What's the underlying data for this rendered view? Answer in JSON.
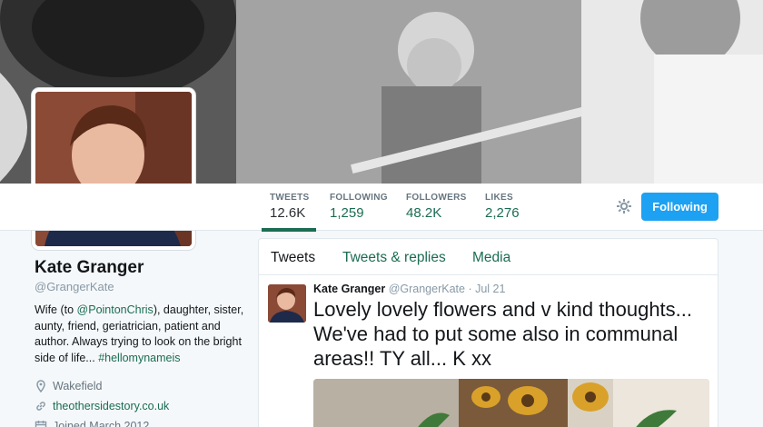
{
  "banner": {
    "alt": ""
  },
  "stats": [
    {
      "label": "TWEETS",
      "value": "12.6K"
    },
    {
      "label": "FOLLOWING",
      "value": "1,259"
    },
    {
      "label": "FOLLOWERS",
      "value": "48.2K"
    },
    {
      "label": "LIKES",
      "value": "2,276"
    }
  ],
  "follow_button": "Following",
  "profile": {
    "name": "Kate Granger",
    "handle": "@GrangerKate",
    "bio_before": "Wife (to ",
    "bio_mention": "@PointonChris",
    "bio_middle": "), daughter, sister, aunty, friend, geriatrician, patient and author. Always trying to look on the bright side of life... ",
    "bio_hashtag": "#hellomynameis",
    "location": "Wakefield",
    "website": "theothersidestory.co.uk",
    "joined": "Joined March 2012"
  },
  "tabs": [
    "Tweets",
    "Tweets & replies",
    "Media"
  ],
  "tweet": {
    "name": "Kate Granger",
    "handle": "@GrangerKate",
    "date": "· Jul 21",
    "text": "Lovely lovely flowers and v kind thoughts... We've had to put some also in communal areas!! TY all... K xx"
  },
  "colors": {
    "accent": "#1b6c53",
    "button": "#1da1f2"
  },
  "icons": {
    "location": "location-pin-icon",
    "website": "link-icon",
    "joined": "calendar-icon",
    "settings": "gear-icon"
  }
}
